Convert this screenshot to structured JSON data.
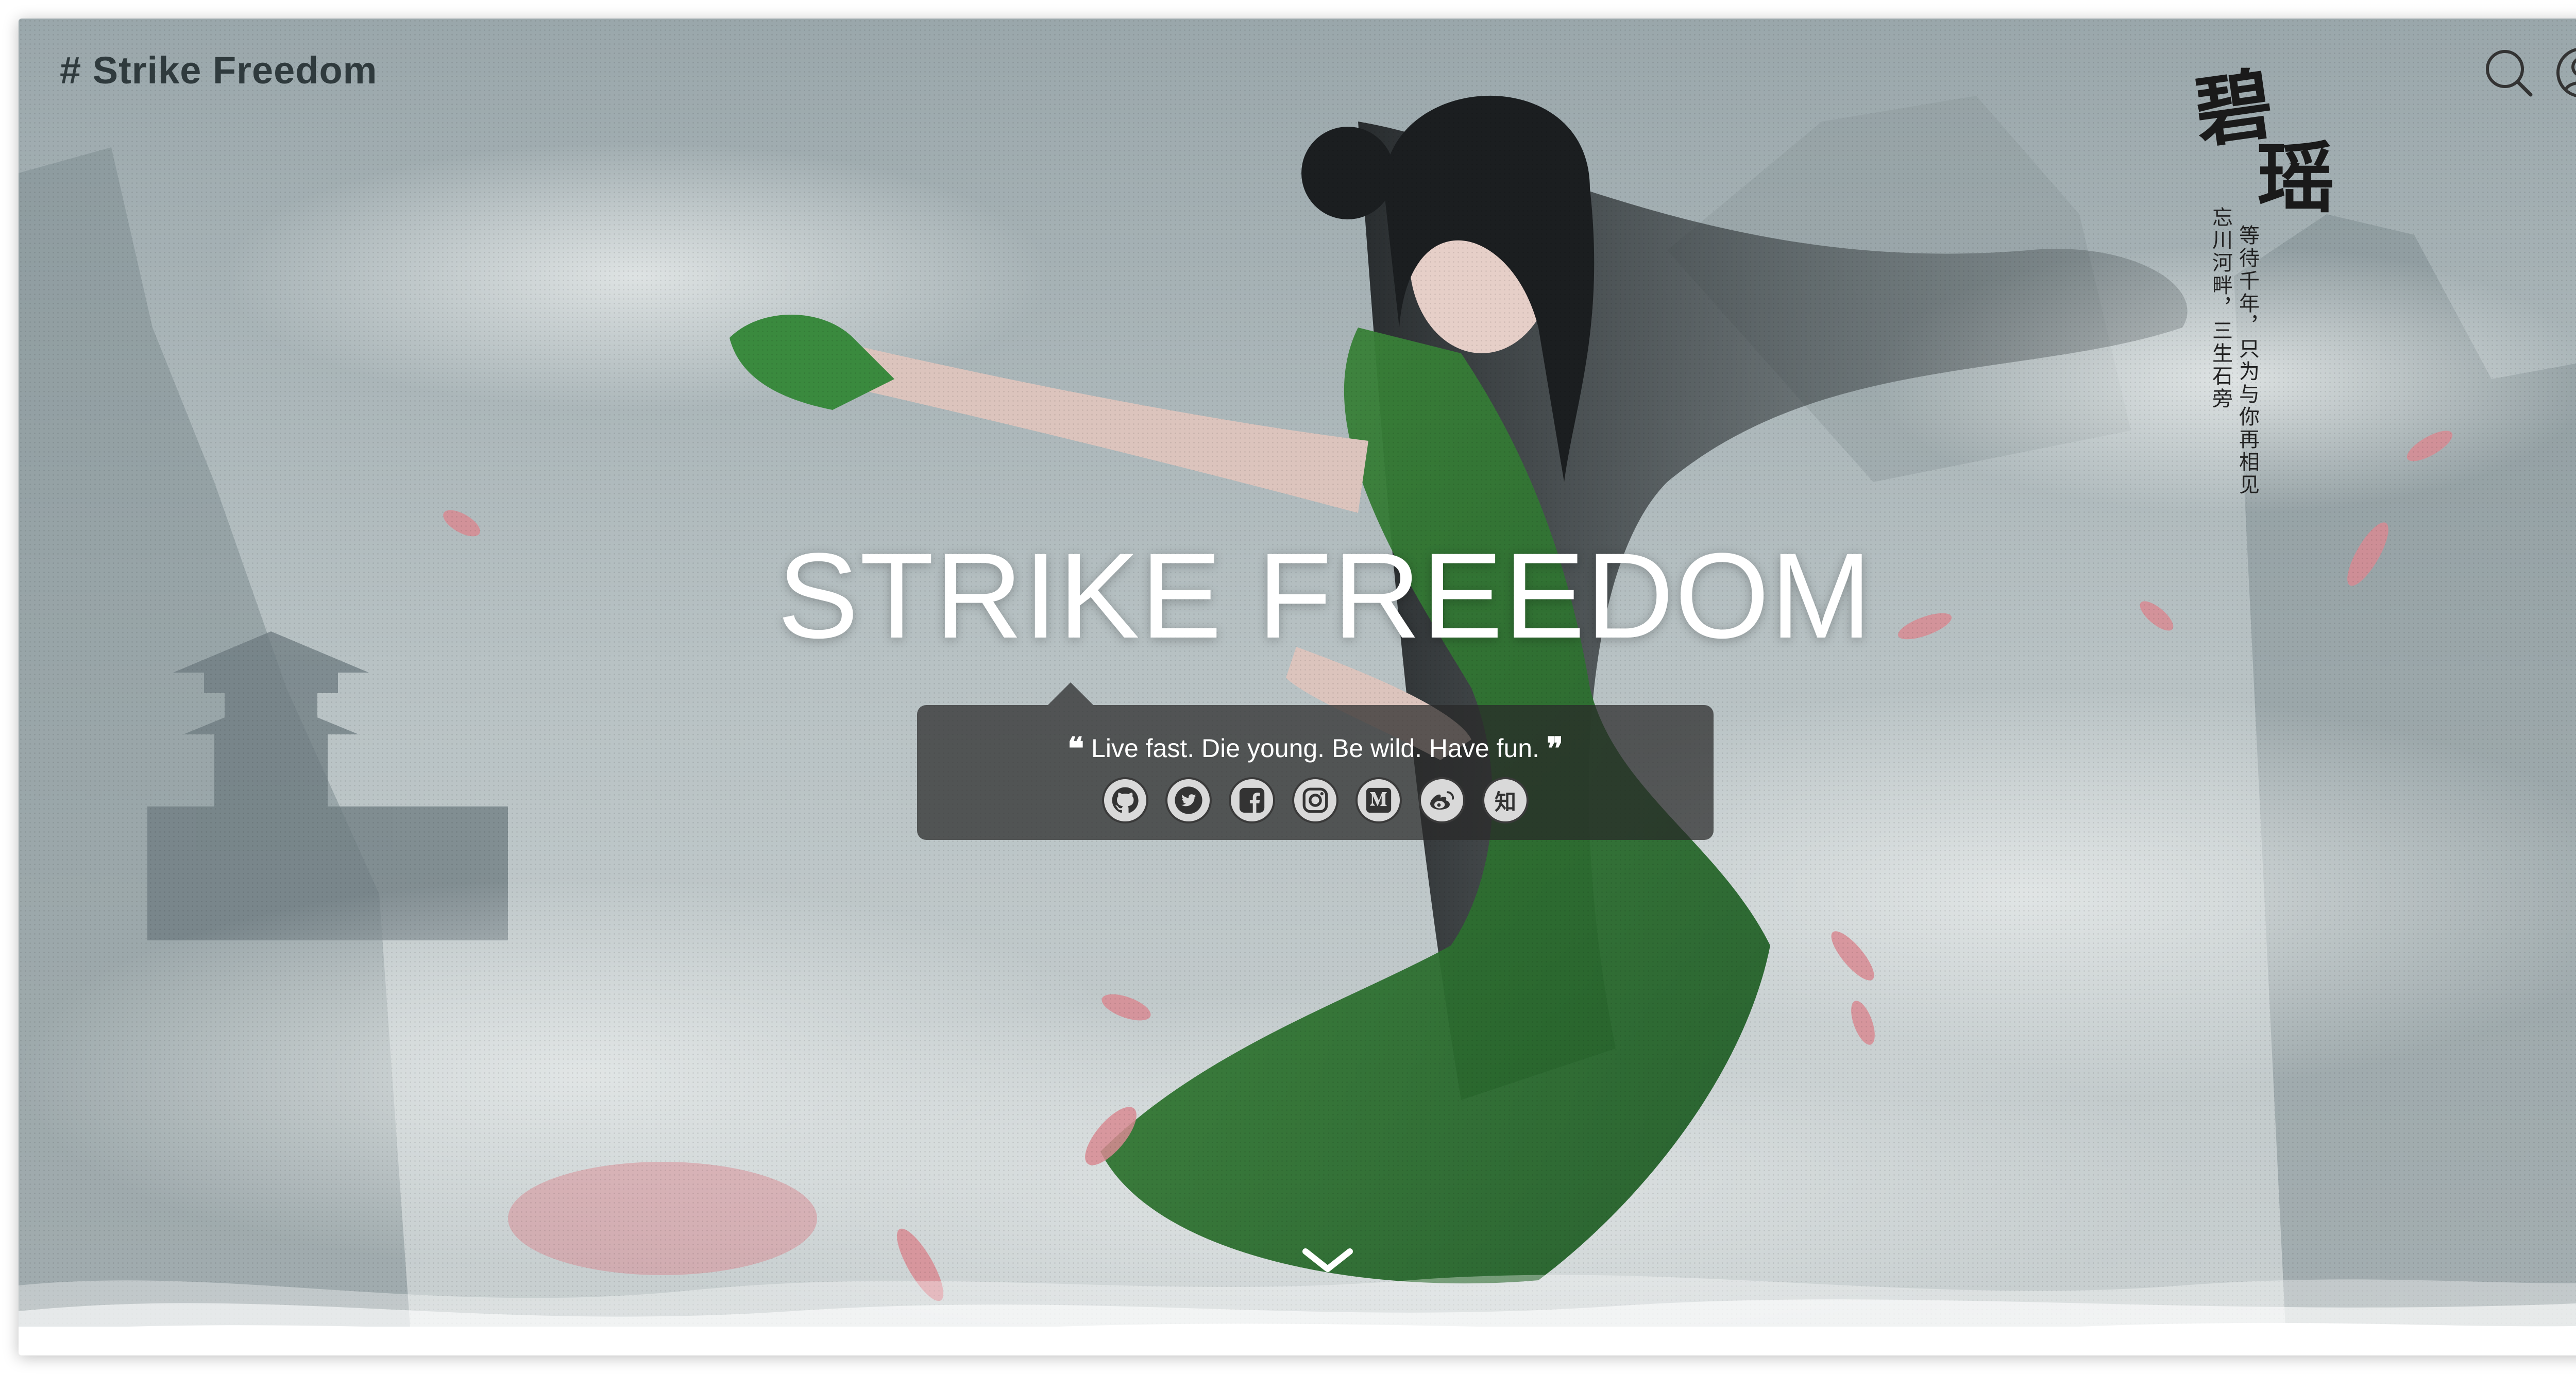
{
  "header": {
    "brand": "# Strike Freedom",
    "search_icon": "search-icon",
    "user_icon": "user-circle-icon"
  },
  "hero": {
    "title": "STRIKE FREEDOM",
    "calligraphy": {
      "char1": "碧",
      "char2": "瑶",
      "line1": "忘川河畔，三生石旁",
      "line2": "等待千年，只为与你再相见"
    }
  },
  "panel": {
    "quote_open": "❝",
    "quote_text": "Live fast. Die young. Be wild. Have fun.",
    "quote_close": "❞",
    "socials": [
      {
        "name": "github-icon"
      },
      {
        "name": "twitter-icon"
      },
      {
        "name": "facebook-icon"
      },
      {
        "name": "instagram-icon"
      },
      {
        "name": "medium-icon"
      },
      {
        "name": "weibo-icon"
      },
      {
        "name": "zhihu-icon",
        "label": "知"
      }
    ]
  },
  "scroll_icon": "chevron-down-icon",
  "colors": {
    "brand_text": "#2f3a3d",
    "title": "#ffffff",
    "panel_bg": "rgba(40,40,40,0.72)",
    "social_bg": "#d9d9d9"
  }
}
